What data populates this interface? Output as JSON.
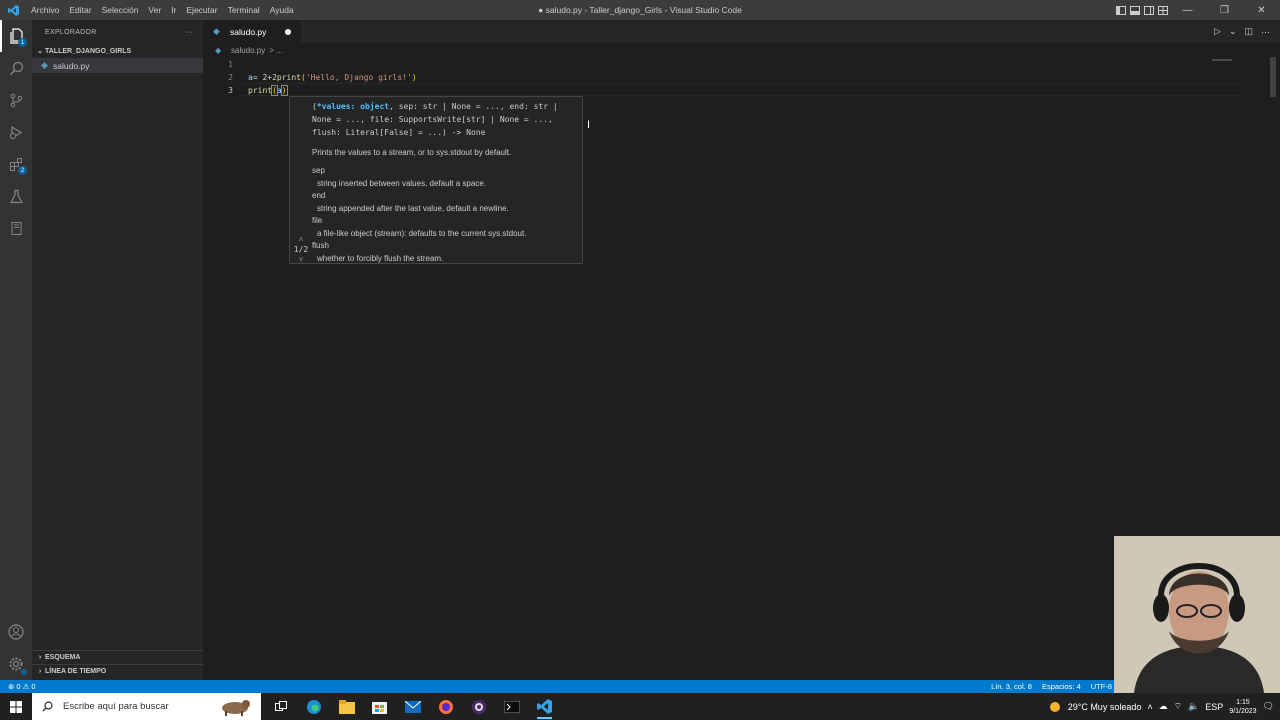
{
  "titlebar": {
    "menu": [
      "Archivo",
      "Editar",
      "Selección",
      "Ver",
      "Ir",
      "Ejecutar",
      "Terminal",
      "Ayuda"
    ],
    "window_title": "● saludo.py - Taller_django_Girls - Visual Studio Code"
  },
  "activitybar": {
    "icons": [
      "explorer-icon",
      "search-icon",
      "source-control-icon",
      "run-debug-icon",
      "extensions-icon",
      "testing-icon",
      "remote-explorer-icon"
    ],
    "extensions_badge": "2",
    "explorer_badge": "1"
  },
  "sidebar": {
    "title": "EXPLORADOR",
    "more": "···",
    "folder": "TALLER_DJANGO_GIRLS",
    "files": [
      "saludo.py"
    ],
    "outline": "ESQUEMA",
    "timeline": "LÍNEA DE TIEMPO"
  },
  "editor": {
    "tab_label": "saludo.py",
    "breadcrumb_file": "saludo.py",
    "breadcrumb_more": "> ...",
    "lines": [
      {
        "n": "1"
      },
      {
        "n": "2"
      },
      {
        "n": "3"
      }
    ],
    "code": {
      "l1_fn": "print",
      "l1_open": "(",
      "l1_str": "'Hello, Django girls!'",
      "l1_close": ")",
      "l2_var": "a",
      "l2_rest": "= 2+2",
      "l3_fn": "print",
      "l3_open": "(",
      "l3_arg": "a",
      "l3_close": ")"
    }
  },
  "signature_help": {
    "nav": "1/2",
    "sig_open": "(",
    "sig_active": "*values: object",
    "sig_rest": ", sep: str | None = ..., end: str | None = ..., file: SupportsWrite[str] | None = ..., flush: Literal[False] = ...) -> None",
    "summary": "Prints the values to a stream, or to sys.stdout by default.",
    "params": [
      {
        "name": "sep",
        "desc": "string inserted between values, default a space."
      },
      {
        "name": "end",
        "desc": "string appended after the last value, default a newline."
      },
      {
        "name": "file",
        "desc": "a file-like object (stream): defaults to the current sys.stdout."
      },
      {
        "name": "flush",
        "desc": "whether to forcibly flush the stream."
      }
    ]
  },
  "statusbar": {
    "problems": "⊗ 0 ⚠ 0",
    "position": "Lín. 3, col. 8",
    "spaces": "Espacios: 4",
    "encoding": "UTF-8"
  },
  "taskbar": {
    "search_placeholder": "Escribe aquí para buscar",
    "weather": "29°C  Muy soleado",
    "language": "ESP",
    "time": "1:15",
    "date": "9/1/2023",
    "apps": [
      "task-view-icon",
      "edge-icon",
      "file-explorer-icon",
      "store-icon",
      "mail-icon",
      "firefox-icon",
      "obs-icon",
      "terminal-icon",
      "vscode-icon"
    ]
  }
}
